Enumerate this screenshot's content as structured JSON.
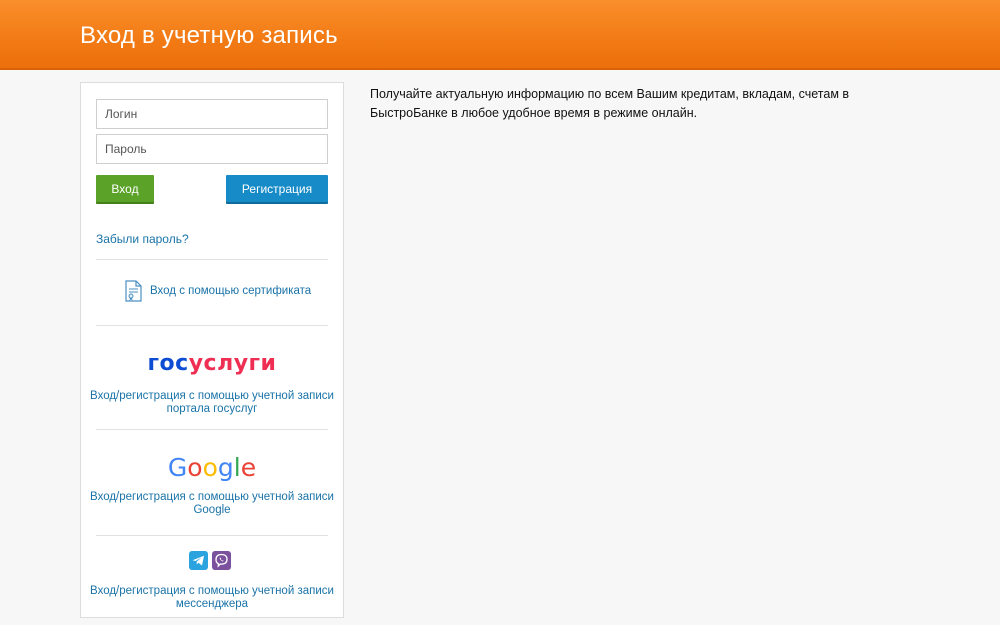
{
  "header": {
    "title": "Вход в учетную запись"
  },
  "login_form": {
    "login_placeholder": "Логин",
    "password_placeholder": "Пароль",
    "login_button": "Вход",
    "register_button": "Регистрация",
    "forgot_password": "Забыли пароль?"
  },
  "certificate": {
    "label": "Вход с помощью сертификата",
    "icon": "certificate-icon"
  },
  "gosuslugi": {
    "logo_part1": "гос",
    "logo_part2": "услуги",
    "line1": "Вход/регистрация с помощью учетной записи",
    "line2": "портала госуслуг",
    "colors": {
      "blue": "#0d4cd3",
      "red": "#ee2f53"
    }
  },
  "google": {
    "logo_letters": [
      "G",
      "o",
      "o",
      "g",
      "l",
      "e"
    ],
    "line1": "Вход/регистрация с помощью учетной записи",
    "line2": "Google",
    "colors": [
      "#4285f4",
      "#ea4335",
      "#fbbc05",
      "#4285f4",
      "#34a853",
      "#ea4335"
    ]
  },
  "messenger": {
    "line1": "Вход/регистрация с помощью учетной записи",
    "line2": "мессенджера",
    "icons": [
      "telegram-icon",
      "viber-icon"
    ]
  },
  "info": {
    "line1": "Получайте актуальную информацию по всем Вашим кредитам, вкладам, счетам в",
    "line2": "БыстроБанке в любое удобное время в режиме онлайн."
  },
  "theme": {
    "header_orange": "#f27a14",
    "login_green": "#5aa228",
    "register_blue": "#178bc7",
    "link_blue": "#1a73a8"
  }
}
